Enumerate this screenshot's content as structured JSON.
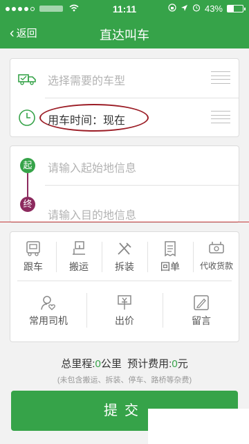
{
  "status_bar": {
    "time": "11:11",
    "battery_percent": "43%",
    "battery_level": 0.43,
    "icons": [
      "signal-dots-icon",
      "wifi-icon",
      "lock-rotation-icon",
      "location-arrow-icon",
      "alarm-icon",
      "battery-icon"
    ]
  },
  "nav": {
    "back_label": "返回",
    "title": "直达叫车"
  },
  "vehicle_row": {
    "placeholder": "选择需要的车型",
    "icon": "truck-icon"
  },
  "time_row": {
    "text": "用车时间：现在",
    "icon": "clock-icon"
  },
  "route": {
    "start_badge": "起",
    "start_placeholder": "请输入起始地信息",
    "end_badge": "终",
    "end_placeholder": "请输入目的地信息"
  },
  "options_row1": [
    {
      "label": "跟车",
      "icon": "follow-car-icon"
    },
    {
      "label": "搬运",
      "icon": "carry-icon"
    },
    {
      "label": "拆装",
      "icon": "tools-icon"
    },
    {
      "label": "回单",
      "icon": "receipt-icon"
    },
    {
      "label": "代收货款",
      "icon": "cash-collect-icon"
    }
  ],
  "options_row2": [
    {
      "label": "常用司机",
      "icon": "favorite-driver-icon"
    },
    {
      "label": "出价",
      "icon": "bid-icon"
    },
    {
      "label": "留言",
      "icon": "note-edit-icon"
    }
  ],
  "summary": {
    "distance_label": "总里程:",
    "distance_value": "0",
    "distance_unit": "公里",
    "cost_label": "预计费用:",
    "cost_value": "0",
    "cost_unit": "元",
    "note": "(未包含搬运、拆装、停车、路桥等杂费)"
  },
  "submit_label": "提交",
  "colors": {
    "primary": "#36a349",
    "end_marker": "#8c2a5e",
    "annotation": "#9b1c25"
  }
}
